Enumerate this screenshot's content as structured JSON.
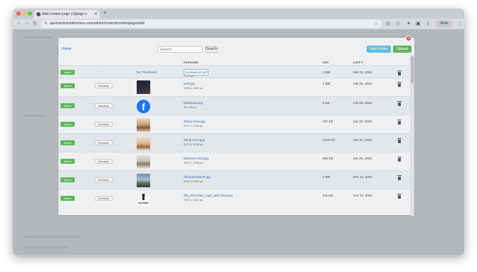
{
  "browser": {
    "tab_title": "Add content page | Django s",
    "url": "quickandsimplehomes.com/admin/content/contentpage/add/",
    "profile": "Work"
  },
  "modal": {
    "breadcrumb": "Home",
    "search_placeholder": "Search",
    "search_button": "Search",
    "new_folder_button": "New Folder",
    "upload_button": "Upload",
    "columns": {
      "filename": "Filename",
      "size": "Size",
      "date": "Date ▾"
    },
    "rows": [
      {
        "insert": "Insert",
        "versions": "-",
        "thumbnail": "No Thumbnail",
        "filename": "rg-playbook.pdf",
        "dims": "0 x 0 px",
        "size": "3 MB",
        "date": "Mar 01, 2026",
        "thumb_kind": "none",
        "selected": true
      },
      {
        "insert": "Insert",
        "versions": "Versions",
        "thumbnail": "",
        "filename": "josh.jpg",
        "dims": "3456 x 1168 px",
        "size": "1 MB",
        "date": "Feb 09, 2026",
        "thumb_kind": "photo-dark"
      },
      {
        "insert": "Insert",
        "versions": "Versions",
        "thumbnail": "",
        "filename": "facebook.png",
        "dims": "50 x 50 px",
        "size": "4 KB",
        "date": "Feb 06, 2026",
        "thumb_kind": "facebook"
      },
      {
        "insert": "Insert",
        "versions": "Versions",
        "thumbnail": "",
        "filename": "dining-area.jpg",
        "dims": "3072 x 2048 px",
        "size": "787 KB",
        "date": "Jan 20, 2026",
        "thumb_kind": "photo-room"
      },
      {
        "insert": "Insert",
        "versions": "Versions",
        "thumbnail": "",
        "filename": "living-room.jpg",
        "dims": "3072 x 2048 px",
        "size": "1019 KB",
        "date": "Jan 20, 2026",
        "thumb_kind": "photo-room2"
      },
      {
        "insert": "Insert",
        "versions": "Versions",
        "thumbnail": "",
        "filename": "bedroom-shot.jpg",
        "dims": "3072 x 2048 px",
        "size": "996 KB",
        "date": "Jan 20, 2026",
        "thumb_kind": "photo-bed"
      },
      {
        "insert": "Insert",
        "versions": "Versions",
        "thumbnail": "",
        "filename": "hillcrest-banner.jpg",
        "dims": "4032 x 2687 px",
        "size": "2 MB",
        "date": "Dec 12, 2025",
        "thumb_kind": "photo-sky"
      },
      {
        "insert": "Insert",
        "versions": "Versions",
        "thumbnail": "",
        "filename": "blk_secondary_logo_and_feet.png",
        "dims": "7627 x 3112 px",
        "size": "115 KB",
        "date": "Nov 12, 2025",
        "thumb_kind": "logo",
        "logo_text": "SALSEDO"
      }
    ]
  },
  "colors": {
    "insert": "#5cb85c",
    "new_folder": "#5bc0de",
    "upload": "#5cb85c",
    "close": "#c9302c",
    "link": "#2a6ab0"
  }
}
